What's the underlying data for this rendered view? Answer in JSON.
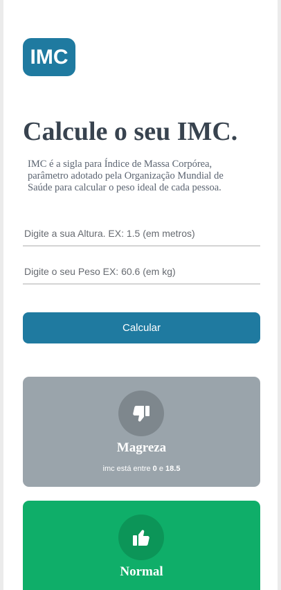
{
  "logo": {
    "text": "IMC"
  },
  "heading": "Calcule o seu IMC.",
  "description": "IMC é a sigla para Índice de Massa Corpórea, parâmetro adotado pela Organização Mundial de Saúde para calcular o peso ideal de cada pessoa.",
  "form": {
    "height_placeholder": "Digite a sua Altura. EX: 1.5 (em metros)",
    "weight_placeholder": "Digite o seu Peso EX: 60.6 (em kg)",
    "submit_label": "Calcular"
  },
  "results": [
    {
      "icon": "thumbs-down-icon",
      "title": "Magreza",
      "info_prefix": "imc está entre",
      "min": "0",
      "joiner": "e",
      "max": "18.5",
      "color": "#9aa4ab"
    },
    {
      "icon": "thumbs-up-icon",
      "title": "Normal",
      "color": "#0fae69"
    }
  ],
  "colors": {
    "accent": "#1f7aa0",
    "heading": "#38434f"
  }
}
